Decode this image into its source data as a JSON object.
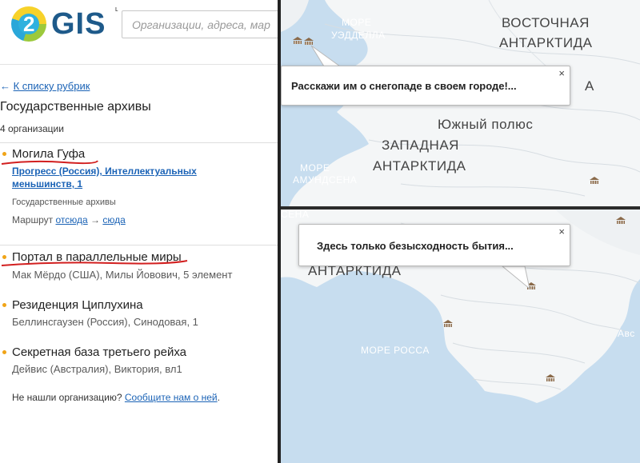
{
  "app": {
    "logo_num": "2",
    "logo_text": "GIS",
    "logo_mark": "ᶫ",
    "search_placeholder": "Организации, адреса, мар"
  },
  "sidebar": {
    "back_link_arrow": "←",
    "back_link": "К списку рубрик",
    "title": "Государственные архивы",
    "count": "4 организации",
    "orgs": [
      {
        "name": "Могила Гуфа",
        "address": "Прогресс (Россия), Интеллектуальных меньшинств, 1",
        "rubric": "Государственные архивы",
        "route_label": "Маршрут",
        "route_from": "отсюда",
        "route_arrow": "→",
        "route_to": "сюда"
      },
      {
        "name": "Портал в параллельные миры",
        "address": "Мак Мёрдо (США), Милы Йовович, 5 элемент"
      },
      {
        "name": "Резиденция Циплухина",
        "address": "Беллинсгаузен (Россия), Синодовая, 1"
      },
      {
        "name": "Секретная база третьего рейха",
        "address": "Дейвис (Австралия), Виктория, вл1"
      }
    ],
    "not_found_text": "Не нашли организацию?",
    "not_found_link": "Сообщите нам о ней",
    "not_found_dot": "."
  },
  "map_top": {
    "labels": {
      "sea_weddell_1": "МОРЕ",
      "sea_weddell_2": "УЭДДЕЛЛА",
      "east_1": "ВОСТОЧНАЯ",
      "east_2": "АНТАРКТИДА",
      "cut_a": "А",
      "south_pole": "Южный полюс",
      "west_1": "ЗАПАДНАЯ",
      "west_2": "АНТАРКТИДА",
      "sea_amundsen_1": "МОРЕ",
      "sea_amundsen_2": "АМУНДСЕНА"
    },
    "popup_text": "Расскажи им о снегопаде в своем городе!...",
    "popup_close": "×"
  },
  "map_bottom": {
    "labels": {
      "sena": "СЕНА",
      "antarctida": "АНТАРКТИДА",
      "ross": "МОРЕ РОССА",
      "cut_right": "Авс"
    },
    "popup_text": "Здесь только безысходность бытия...",
    "popup_close": "×"
  },
  "colors": {
    "sea": "#c7ddef",
    "land": "#f4f6f7",
    "link": "#1b63b6",
    "bullet": "#f0a417",
    "marker": "#8a6a4a",
    "annotation": "#d21f1f"
  },
  "icons": {
    "marker": "archive-building-icon",
    "close": "close-icon",
    "logo": "2gis-logo-icon"
  }
}
